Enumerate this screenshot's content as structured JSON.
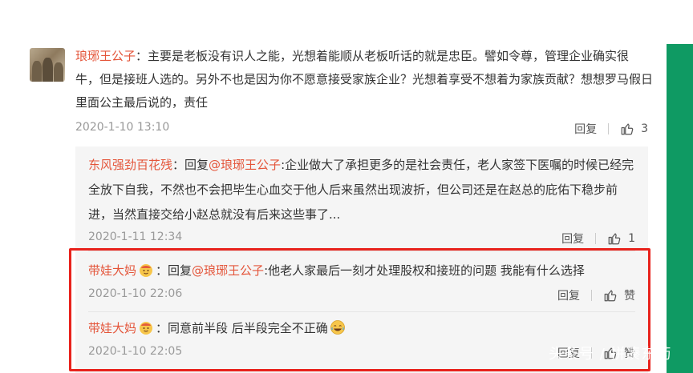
{
  "main_comment": {
    "author": "琅琊王公子",
    "sep": "：",
    "text": "主要是老板没有识人之能，光想着能顺从老板听话的就是忠臣。譬如令尊，管理企业确实很牛，但是接班人选的。另外不也是因为你不愿意接受家族企业？光想着享受不想着为家族贡献？想想罗马假日里面公主最后说的，责任",
    "time": "2020-1-10 13:10",
    "reply_label": "回复",
    "like_count": "3"
  },
  "replies": [
    {
      "author": "东风强劲百花残",
      "sep": "：",
      "reply_prefix": "回复",
      "reply_to": "@琅琊王公子",
      "text": ":企业做大了承担更多的是社会责任，老人家签下医嘱的时候已经完全放下自我，不然也不会把毕生心血交于他人后来虽然出现波折，但公司还是在赵总的庇佑下稳步前进，当然直接交给小赵总就没有后来这些事了...",
      "time": "2020-1-11 12:34",
      "reply_label": "回复",
      "like_label": "1"
    },
    {
      "author": "带娃大妈",
      "sep": "：",
      "reply_prefix": "回复",
      "reply_to": "@琅琊王公子",
      "text": ":他老人家最后一刻才处理股权和接班的问题 我能有什么选择",
      "time": "2020-1-10 22:06",
      "reply_label": "回复",
      "like_label": "赞"
    },
    {
      "author": "带娃大妈",
      "sep": "：",
      "text": "同意前半段 后半段完全不正确",
      "time": "2020-1-10 22:05",
      "reply_label": "回复",
      "like_label": "赞"
    }
  ],
  "watermark": "头条号 / 拼凑东药",
  "colors": {
    "author": "#e4553a",
    "highlight": "#e8221c",
    "stripe": "#0f9a63"
  },
  "icons": {
    "like": "thumbs-up-icon",
    "badge": "mom-badge-icon",
    "laugh": "laughing-emoji-icon"
  }
}
